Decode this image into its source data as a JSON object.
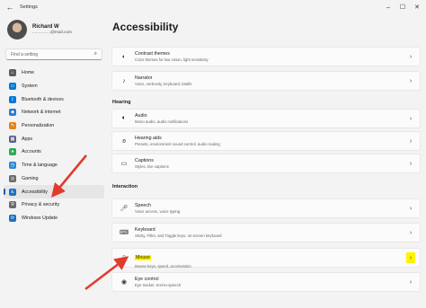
{
  "window": {
    "title": "Settings",
    "back_icon": "back-arrow-icon",
    "controls": [
      "minimize-icon",
      "maximize-icon",
      "close-icon"
    ]
  },
  "profile": {
    "name": "Richard W",
    "email": "...............@mail.com"
  },
  "search": {
    "placeholder": "Find a setting"
  },
  "nav": [
    {
      "label": "Home",
      "icon": "home-icon",
      "color": "#5b5b5b"
    },
    {
      "label": "System",
      "icon": "system-icon",
      "color": "#0078d4"
    },
    {
      "label": "Bluetooth & devices",
      "icon": "bluetooth-icon",
      "color": "#0078d4"
    },
    {
      "label": "Network & internet",
      "icon": "network-icon",
      "color": "#2a7bd1"
    },
    {
      "label": "Personalization",
      "icon": "personalization-icon",
      "color": "#e3811e"
    },
    {
      "label": "Apps",
      "icon": "apps-icon",
      "color": "#5a5f8f"
    },
    {
      "label": "Accounts",
      "icon": "accounts-icon",
      "color": "#2eab5c"
    },
    {
      "label": "Time & language",
      "icon": "time-language-icon",
      "color": "#2b88d8"
    },
    {
      "label": "Gaming",
      "icon": "gaming-icon",
      "color": "#6b6b6b"
    },
    {
      "label": "Accessibility",
      "icon": "accessibility-icon",
      "color": "#1a73c7"
    },
    {
      "label": "Privacy & security",
      "icon": "shield-icon",
      "color": "#6b6b6b"
    },
    {
      "label": "Windows Update",
      "icon": "update-icon",
      "color": "#1a73c7"
    }
  ],
  "main": {
    "title": "Accessibility",
    "vision_cards": [
      {
        "title": "Contrast themes",
        "desc": "Color themes for low vision, light sensitivity",
        "icon": "contrast-icon"
      },
      {
        "title": "Narrator",
        "desc": "Voice, verbosity, keyboard, braille",
        "icon": "narrator-icon"
      }
    ],
    "hearing_heading": "Hearing",
    "hearing_cards": [
      {
        "title": "Audio",
        "desc": "Mono audio, audio notifications",
        "icon": "audio-icon"
      },
      {
        "title": "Hearing aids",
        "desc": "Presets, environment sound control, audio routing",
        "icon": "hearing-aids-icon"
      },
      {
        "title": "Captions",
        "desc": "Styles, live captions",
        "icon": "captions-icon"
      }
    ],
    "interaction_heading": "Interaction",
    "interaction_cards": [
      {
        "title": "Speech",
        "desc": "Voice access, voice typing",
        "icon": "microphone-icon"
      },
      {
        "title": "Keyboard",
        "desc": "Sticky, Filter, and Toggle keys, on-screen keyboard",
        "icon": "keyboard-icon"
      },
      {
        "title": "Mouse",
        "desc": "Mouse keys, speed, acceleration",
        "icon": "mouse-icon"
      },
      {
        "title": "Eye control",
        "desc": "Eye tracker, text-to-speech",
        "icon": "eye-icon"
      }
    ]
  },
  "highlight_color": "#fff200",
  "annotation_arrow_color": "#e23b2e"
}
